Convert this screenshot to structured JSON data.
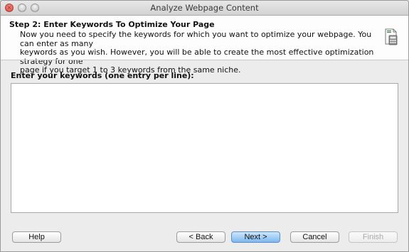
{
  "window": {
    "title": "Analyze Webpage Content"
  },
  "step": {
    "title": "Step 2: Enter Keywords To Optimize Your Page",
    "description_lines": [
      "Now you need to specify the keywords for which you want to optimize your webpage. You can enter as many",
      "keywords as you wish. However, you will be able to create the most effective optimization strategy for one",
      "page if you target 1 to 3 keywords from the same niche."
    ],
    "icon": "document-calculator-icon"
  },
  "keywords": {
    "label": "Enter your keywords (one entry per line):",
    "value": ""
  },
  "buttons": {
    "help": "Help",
    "back": "< Back",
    "next": "Next >",
    "cancel": "Cancel",
    "finish": "Finish"
  },
  "colors": {
    "default_button": "#7db8ef",
    "close_dot": "#e0443a",
    "header_bg": "#fdfdfd",
    "window_bg": "#ececec"
  }
}
